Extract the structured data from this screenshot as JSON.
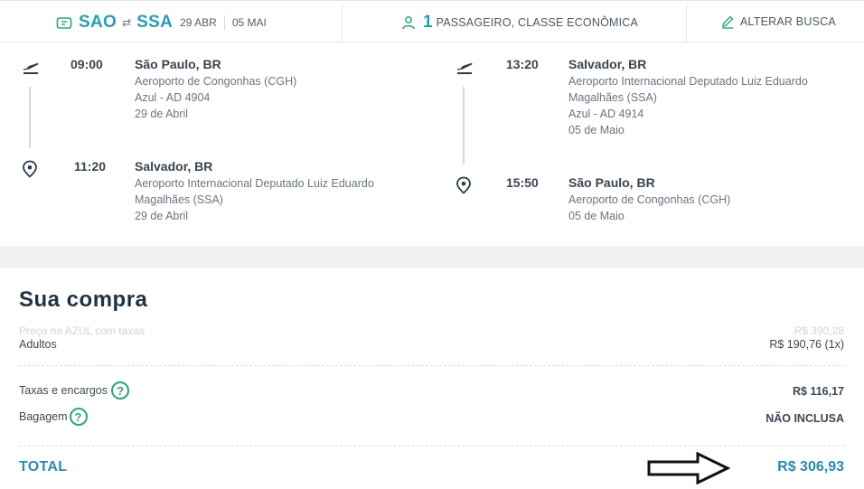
{
  "header": {
    "origin": "SAO",
    "destination": "SSA",
    "depart_date": "29 ABR",
    "return_date": "05 MAI",
    "passenger_count": "1",
    "passenger_text": "PASSAGEIRO, CLASSE ECONÔMICA",
    "edit_label": "ALTERAR BUSCA"
  },
  "outbound": {
    "departure": {
      "time": "09:00",
      "city": "São Paulo, BR",
      "airport": "Aeroporto de Congonhas (CGH)",
      "flight": "Azul - AD 4904",
      "date": "29 de Abril"
    },
    "arrival": {
      "time": "11:20",
      "city": "Salvador, BR",
      "airport_line1": "Aeroporto Internacional Deputado Luiz Eduardo",
      "airport_line2": "Magalhães (SSA)",
      "date": "29 de Abril"
    }
  },
  "return": {
    "departure": {
      "time": "13:20",
      "city": "Salvador, BR",
      "airport_line1": "Aeroporto Internacional Deputado Luiz Eduardo",
      "airport_line2": "Magalhães (SSA)",
      "flight": "Azul - AD 4914",
      "date": "05 de Maio"
    },
    "arrival": {
      "time": "15:50",
      "city": "São Paulo, BR",
      "airport": "Aeroporto de Congonhas (CGH)",
      "date": "05 de Maio"
    }
  },
  "purchase": {
    "title": "Sua compra",
    "azul_price_label": "Preço na AZUL com taxas",
    "azul_price_value": "R$ 390,28",
    "adults_label": "Adultos",
    "adults_value": "R$ 190,76 (1x)",
    "taxes_label": "Taxas e encargos",
    "taxes_value": "R$ 116,17",
    "baggage_label": "Bagagem",
    "baggage_value": "NÃO INCLUSA",
    "total_label": "TOTAL",
    "total_value": "R$ 306,93"
  },
  "colors": {
    "accent": "#2a9db4",
    "help": "#2ca47b",
    "total": "#2a8bb0"
  },
  "icons": {
    "ticket": "ticket-icon",
    "swap": "swap-icon",
    "person": "person-icon",
    "edit": "pencil-icon",
    "takeoff": "plane-takeoff-icon",
    "pin": "location-pin-icon",
    "help": "help-icon",
    "arrow": "arrow-right-icon"
  }
}
